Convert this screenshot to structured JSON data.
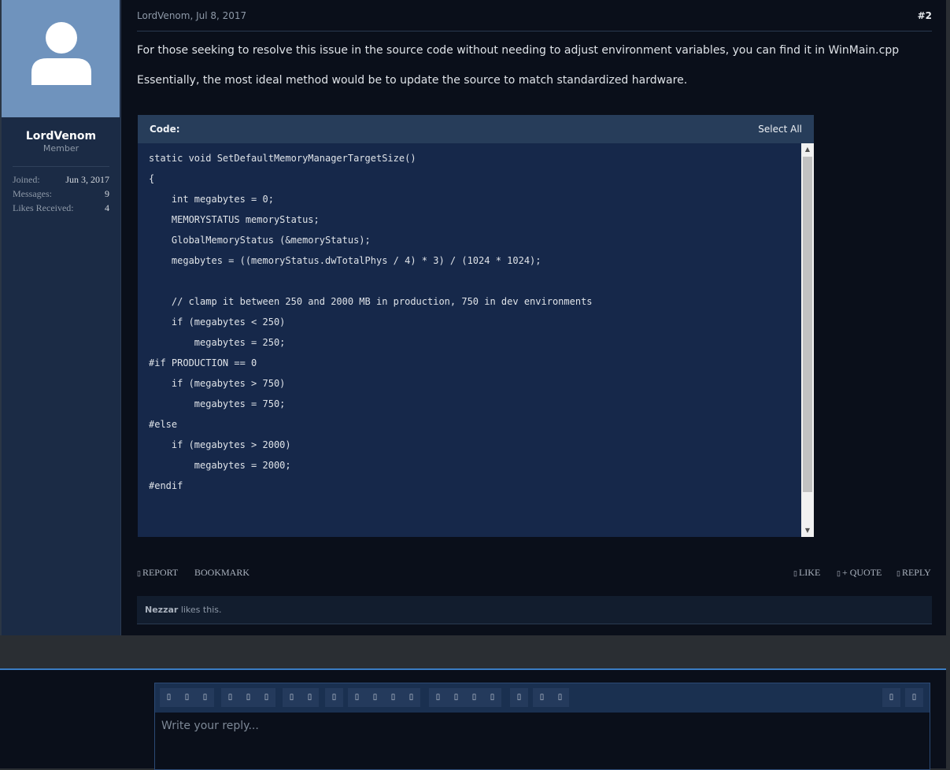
{
  "user": {
    "name": "LordVenom",
    "title": "Member",
    "stats": [
      {
        "label": "Joined:",
        "value": "Jun 3, 2017"
      },
      {
        "label": "Messages:",
        "value": "9"
      },
      {
        "label": "Likes Received:",
        "value": "4"
      }
    ]
  },
  "post": {
    "author_date": "LordVenom, Jul 8, 2017",
    "number": "#2",
    "paragraphs": [
      "For those seeking to resolve this issue in the source code without needing to adjust environment variables, you can find it in WinMain.cpp",
      "Essentially, the most ideal method would be to update the source to match standardized hardware."
    ]
  },
  "code": {
    "label": "Code:",
    "select_all": "Select All",
    "lines": [
      "static void SetDefaultMemoryManagerTargetSize()",
      "{",
      "    int megabytes = 0;",
      "    MEMORYSTATUS memoryStatus;",
      "    GlobalMemoryStatus (&memoryStatus);",
      "    megabytes = ((memoryStatus.dwTotalPhys / 4) * 3) / (1024 * 1024);",
      "",
      "    // clamp it between 250 and 2000 MB in production, 750 in dev environments",
      "    if (megabytes < 250)",
      "        megabytes = 250;",
      "#if PRODUCTION == 0",
      "    if (megabytes > 750)",
      "        megabytes = 750;",
      "#else",
      "    if (megabytes > 2000)",
      "        megabytes = 2000;",
      "#endif"
    ]
  },
  "actions": {
    "report": "REPORT",
    "bookmark": "BOOKMARK",
    "like": "LIKE",
    "quote": "+ QUOTE",
    "reply": "REPLY",
    "icon_glyph": "▯"
  },
  "likes": {
    "user": "Nezzar",
    "text": " likes this."
  },
  "editor": {
    "placeholder": "Write your reply...",
    "tool_glyph": "▯"
  },
  "colors": {
    "accent": "#3a7dc4",
    "avatar_bg": "#6f93bd"
  }
}
